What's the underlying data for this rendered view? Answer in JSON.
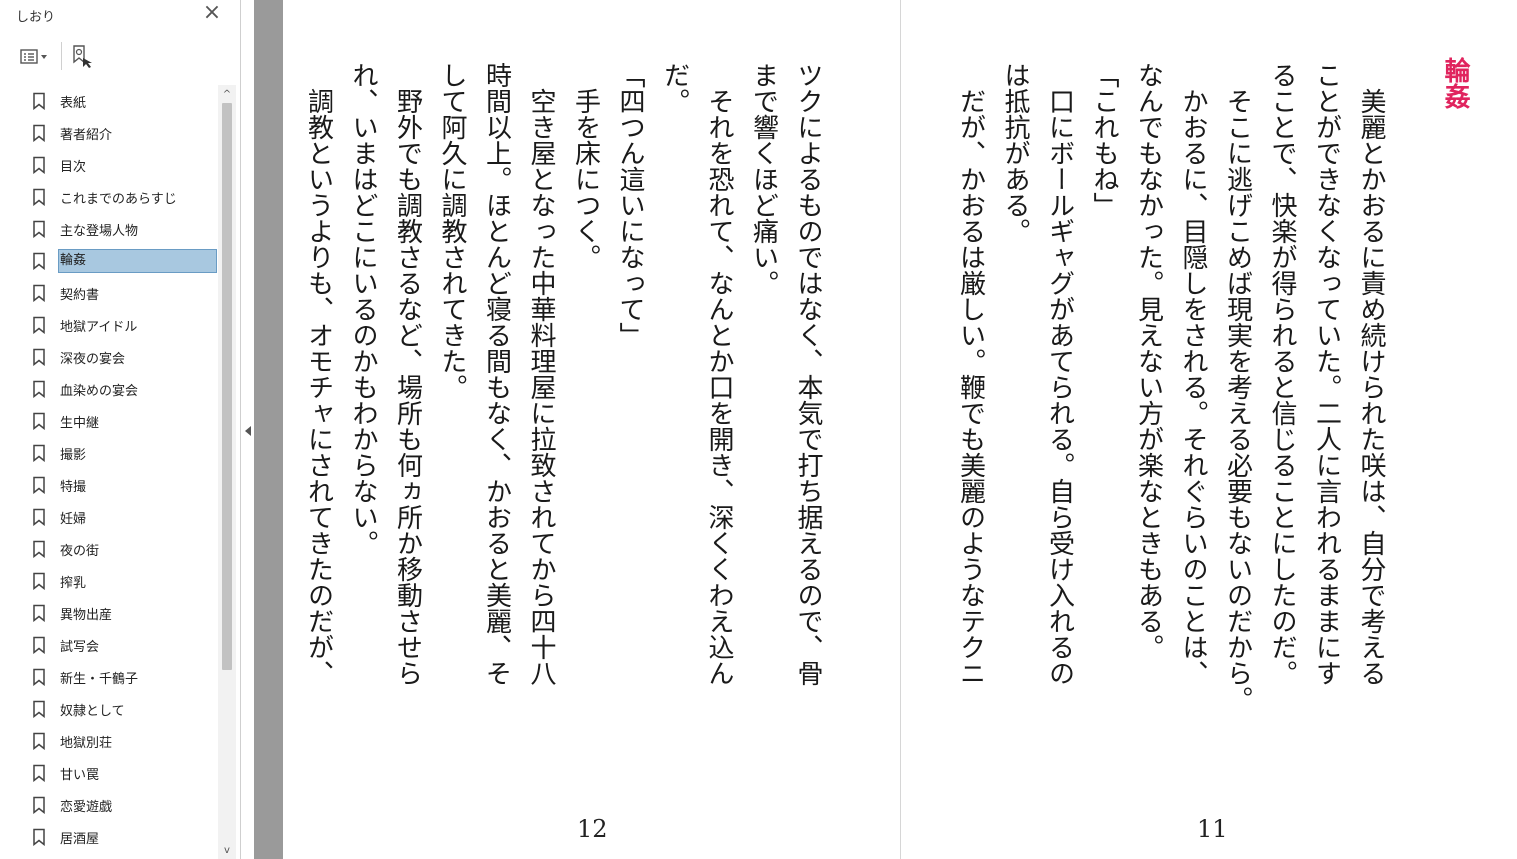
{
  "sidebar": {
    "title": "しおり",
    "close_symbol": "×",
    "toolbar": {
      "options_icon": "list-options-icon",
      "new_bookmark_icon": "new-bookmark-icon"
    },
    "bookmarks": [
      {
        "label": "表紙"
      },
      {
        "label": "著者紹介"
      },
      {
        "label": "目次"
      },
      {
        "label": "これまでのあらすじ"
      },
      {
        "label": "主な登場人物"
      },
      {
        "label": "輪姦",
        "selected": true
      },
      {
        "label": "契約書"
      },
      {
        "label": "地獄アイドル"
      },
      {
        "label": "深夜の宴会"
      },
      {
        "label": "血染めの宴会"
      },
      {
        "label": "生中継"
      },
      {
        "label": "撮影"
      },
      {
        "label": "特撮"
      },
      {
        "label": "妊婦"
      },
      {
        "label": "夜の街"
      },
      {
        "label": "搾乳"
      },
      {
        "label": "異物出産"
      },
      {
        "label": "試写会"
      },
      {
        "label": "新生・千鶴子"
      },
      {
        "label": "奴隷として"
      },
      {
        "label": "地獄別荘"
      },
      {
        "label": "甘い罠"
      },
      {
        "label": "恋愛遊戯"
      },
      {
        "label": "居酒屋"
      }
    ],
    "scroll_up_symbol": "^",
    "scroll_down_symbol": "v"
  },
  "document": {
    "chapter_title": "輪姦",
    "accent_color": "#e0245e",
    "left_page": {
      "page_number": "12",
      "columns": [
        "ツクによるものではなく、本気で打ち据えるので、骨",
        "まで響くほど痛い。",
        "　それを恐れて、なんとか口を開き、深くくわえ込ん",
        "だ。",
        "「四つん這いになって」",
        "　手を床につく。",
        "　空き屋となった中華料理屋に拉致されてから四十八",
        "時間以上。ほとんど寝る間もなく、かおると美麗、そ",
        "して阿久に調教されてきた。",
        "　野外でも調教さるなど、場所も何ヵ所か移動させら",
        "れ、いまはどこにいるのかもわからない。",
        "　調教というよりも、オモチャにされてきたのだが、"
      ]
    },
    "right_page": {
      "page_number": "11",
      "columns": [
        "　美麗とかおるに責め続けられた咲は、自分で考える",
        "ことができなくなっていた。二人に言われるままにす",
        "ることで、快楽が得られると信じることにしたのだ。",
        "　そこに逃げこめば現実を考える必要もないのだから。",
        "　かおるに、目隠しをされる。それぐらいのことは、",
        "なんでもなかった。見えない方が楽なときもある。",
        "「これもね」",
        "　口にボールギャグがあてられる。自ら受け入れるの",
        "は抵抗がある。",
        "　だが、かおるは厳しい。鞭でも美麗のようなテクニ"
      ]
    }
  }
}
